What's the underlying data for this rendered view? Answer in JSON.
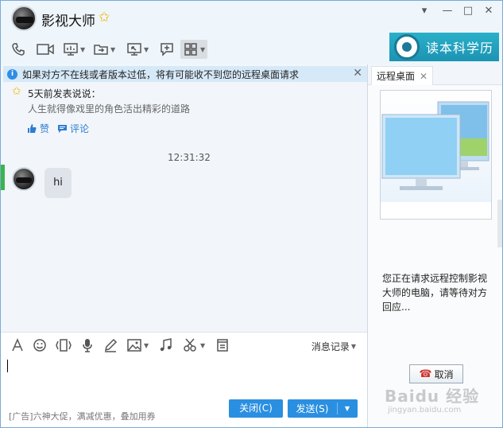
{
  "window": {
    "title": "影视大师",
    "controls": {
      "menu": "▾",
      "minimize": "—",
      "maximize": "□",
      "close": "✕"
    }
  },
  "toolbar": {
    "icons": [
      "phone-icon",
      "video-icon",
      "screen-share-icon",
      "file-transfer-icon",
      "remote-desktop-icon",
      "new-chat-icon",
      "apps-icon"
    ]
  },
  "brand": {
    "text": "读本科学历"
  },
  "notice": {
    "text": "如果对方不在线或者版本过低，将有可能收不到您的远程桌面请求"
  },
  "feed": {
    "title": "5天前发表说说：",
    "body": "人生就得像戏里的角色活出精彩的道路",
    "like_label": "赞",
    "comment_label": "评论"
  },
  "conversation": {
    "timestamp": "12:31:32",
    "messages": [
      {
        "text": "hi"
      }
    ]
  },
  "input": {
    "history_label": "消息记录",
    "ad_text": "[广告]六神大促，满减优惠，叠加用券",
    "close_label": "关闭(C)",
    "send_label": "发送(S)"
  },
  "right_panel": {
    "tab_label": "远程桌面",
    "status_text": "您正在请求远程控制影视大师的电脑，请等待对方回应...",
    "cancel_label": "取消"
  },
  "watermark": {
    "main": "Baidu 经验",
    "sub": "jingyan.baidu.com"
  },
  "colors": {
    "accent": "#2a8fe0",
    "notice_bg": "#d6e9f8",
    "brand_bg": "#1c93b3",
    "online": "#3ab54a"
  }
}
